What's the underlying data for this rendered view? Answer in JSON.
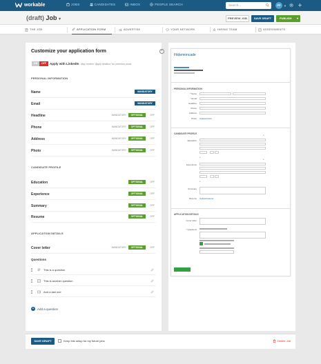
{
  "topbar": {
    "brand": "workable",
    "nav": [
      {
        "label": "JOBS",
        "icon": "briefcase-icon"
      },
      {
        "label": "CANDIDATES",
        "icon": "people-icon"
      },
      {
        "label": "INBOX",
        "icon": "inbox-icon"
      },
      {
        "label": "PEOPLE SEARCH",
        "icon": "globe-icon"
      }
    ],
    "search_placeholder": "Search...",
    "avatar_initials": "FP"
  },
  "header": {
    "draft_label": "(draft)",
    "job_label": "Job",
    "preview_label": "PREVIEW JOB",
    "save_draft_label": "SAVE DRAFT",
    "publish_label": "PUBLISH"
  },
  "tabs": [
    {
      "label": "THE JOB",
      "active": false
    },
    {
      "label": "APPLICATION FORM",
      "active": true
    },
    {
      "label": "ADVERTISE",
      "active": false
    },
    {
      "label": "YOUR NETWORK",
      "active": false
    },
    {
      "label": "HIRING TEAM",
      "active": false
    },
    {
      "label": "ASSESSMENTS",
      "active": false
    }
  ],
  "form": {
    "title": "Customize your application form",
    "linkedin": {
      "on": "ON",
      "off": "OFF",
      "label": "Apply with LinkedIn",
      "note": "May receive \"Apply dealbox\" for premium posts."
    },
    "personal_header": "PERSONAL INFORMATION",
    "personal_fields": [
      {
        "label": "Name",
        "status": "MANDATORY"
      },
      {
        "label": "Email",
        "status": "MANDATORY"
      },
      {
        "label": "Headline",
        "status": "OPTIONAL",
        "left": "MANDATORY",
        "right": "OFF"
      },
      {
        "label": "Phone",
        "status": "OPTIONAL",
        "left": "MANDATORY",
        "right": "OFF"
      },
      {
        "label": "Address",
        "status": "OPTIONAL",
        "left": "MANDATORY",
        "right": "OFF"
      },
      {
        "label": "Photo",
        "status": "OPTIONAL",
        "left": "MANDATORY",
        "right": "OFF"
      }
    ],
    "profile_header": "CANDIDATE PROFILE",
    "profile_fields": [
      {
        "label": "Education",
        "status": "OPTIONAL",
        "right": "OFF"
      },
      {
        "label": "Experience",
        "status": "OPTIONAL",
        "right": "OFF"
      },
      {
        "label": "Summary",
        "status": "OPTIONAL",
        "right": "OFF"
      },
      {
        "label": "Resume",
        "status": "OPTIONAL",
        "right": "OFF"
      }
    ],
    "details_header": "APPLICATION DETAILS",
    "details_fields": [
      {
        "label": "Cover letter",
        "status": "OPTIONAL",
        "left": "MANDATORY",
        "right": "OFF"
      }
    ],
    "questions_header": "Questions",
    "questions": [
      {
        "text": "This is a question",
        "icon": "paragraph-icon"
      },
      {
        "text": "This is another question",
        "icon": "checkbox-icon"
      },
      {
        "text": "And a last one",
        "icon": "list-icon"
      }
    ],
    "add_question": "Add a question"
  },
  "preview": {
    "company": "Fitdemoncade",
    "personal_header": "PERSONAL INFORMATION",
    "personal_labels": [
      "* Name",
      "* Email",
      "Headline",
      "Phone",
      "Address",
      "Photo"
    ],
    "upload_photo": "Upload photo",
    "profile_header": "CANDIDATE PROFILE",
    "education_label": "Education",
    "experience_label": "Experience",
    "summary_label": "Summary",
    "resume_label": "Resume",
    "upload_resume": "Upload resume",
    "details_header": "APPLICATION DETAILS",
    "cover_label": "Cover letter",
    "questions_label": "* Questions"
  },
  "footer": {
    "save_label": "SAVE DRAFT",
    "keep_label": "Keep this setup for my future jobs",
    "delete_label": "Delete Job"
  },
  "colors": {
    "brand_blue": "#1b5a82",
    "optional_green": "#5c9e2e",
    "off_red": "#d9312c"
  }
}
